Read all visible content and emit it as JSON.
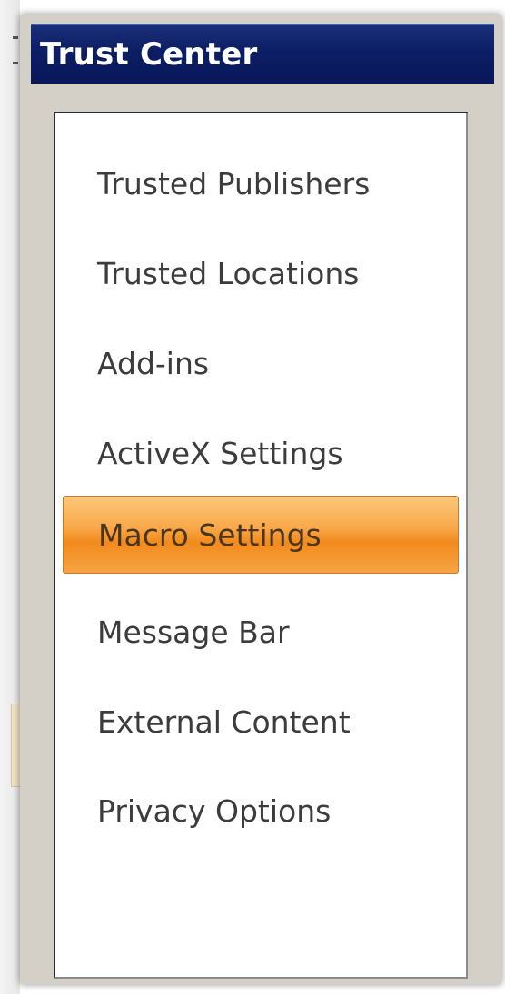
{
  "dialog": {
    "title": "Trust Center"
  },
  "nav": {
    "selected_index": 4,
    "items": [
      {
        "label": "Trusted Publishers"
      },
      {
        "label": "Trusted Locations"
      },
      {
        "label": "Add-ins"
      },
      {
        "label": "ActiveX Settings"
      },
      {
        "label": "Macro Settings"
      },
      {
        "label": "Message Bar"
      },
      {
        "label": "External Content"
      },
      {
        "label": "Privacy Options"
      }
    ]
  },
  "colors": {
    "titlebar": "#0c1e63",
    "selected_highlight": "#f9a94b",
    "dialog_face": "#d4d0c8",
    "nav_text": "#3c3c3c"
  }
}
